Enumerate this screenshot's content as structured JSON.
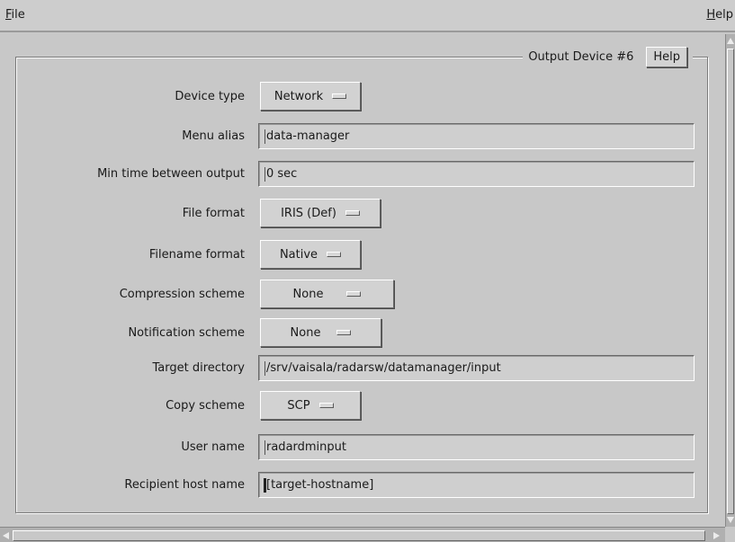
{
  "menubar": {
    "file_mnemonic": "F",
    "file_rest": "ile",
    "help_mnemonic": "H",
    "help_rest": "elp"
  },
  "panel": {
    "title": "Output Device #6",
    "help_label": "Help"
  },
  "fields": {
    "device_type": {
      "label": "Device type",
      "value": "Network"
    },
    "menu_alias": {
      "label": "Menu alias",
      "value": "data-manager"
    },
    "min_time": {
      "label": "Min time between output",
      "value": "0 sec"
    },
    "file_format": {
      "label": "File format",
      "value": "IRIS (Def)"
    },
    "filename_format": {
      "label": "Filename format",
      "value": "Native"
    },
    "compression": {
      "label": "Compression scheme",
      "value": "None"
    },
    "notification": {
      "label": "Notification scheme",
      "value": "None"
    },
    "target_dir": {
      "label": "Target directory",
      "value": "/srv/vaisala/radarsw/datamanager/input"
    },
    "copy_scheme": {
      "label": "Copy scheme",
      "value": "SCP"
    },
    "user_name": {
      "label": "User name",
      "value": "radardminput"
    },
    "recipient_host": {
      "label": "Recipient host name",
      "value": "[target-hostname]"
    }
  },
  "icons": {
    "option_indicator": "option-menu-indicator-icon",
    "scroll_up": "arrow-up-icon",
    "scroll_down": "arrow-down-icon",
    "scroll_left": "arrow-left-icon",
    "scroll_right": "arrow-right-icon"
  },
  "colors": {
    "background": "#c8c8c8",
    "field_background": "#cfcfcf",
    "text": "#1a1a1a"
  }
}
